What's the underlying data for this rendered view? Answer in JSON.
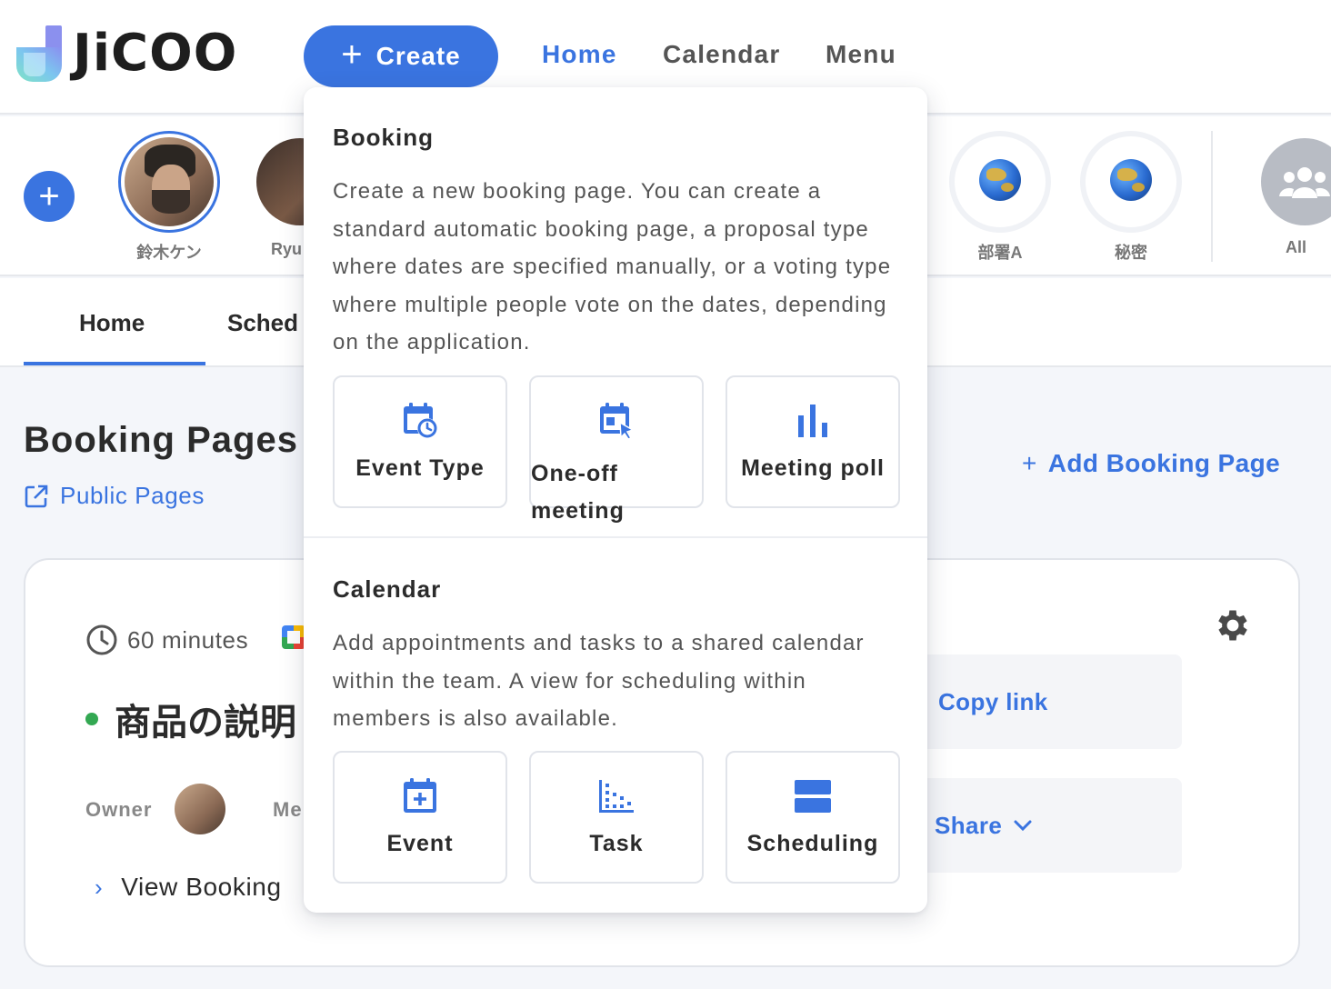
{
  "header": {
    "logo_text": "JiCOO",
    "create_label": "Create",
    "nav": [
      {
        "label": "Home",
        "active": true
      },
      {
        "label": "Calendar",
        "active": false
      },
      {
        "label": "Menu",
        "active": false
      }
    ]
  },
  "members": {
    "items": [
      {
        "label": "鈴木ケン",
        "selected": true
      },
      {
        "label": "Ryu"
      },
      {
        "label": "部署A"
      },
      {
        "label": "秘密"
      },
      {
        "label": "All"
      }
    ]
  },
  "tabs": [
    {
      "label": "Home",
      "active": true
    },
    {
      "label": "Sched"
    }
  ],
  "main": {
    "title": "Booking Pages",
    "public_pages": "Public Pages",
    "add_booking": "Add Booking Page",
    "card": {
      "duration": "60 minutes",
      "title": "商品の説明",
      "owner_label": "Owner",
      "members_label": "Me",
      "view_booking": "View Booking",
      "copy_link": "Copy link",
      "share": "Share"
    }
  },
  "dropdown": {
    "booking": {
      "title": "Booking",
      "description": "Create a new booking page. You can create a standard automatic booking page, a proposal type where dates are specified manually, or a voting type where multiple people vote on the dates, depending on the application.",
      "options": [
        {
          "label": "Event Type",
          "icon": "calendar-clock-icon"
        },
        {
          "label": "One-off meeting",
          "icon": "calendar-cursor-icon"
        },
        {
          "label": "Meeting poll",
          "icon": "bar-chart-icon"
        }
      ]
    },
    "calendar": {
      "title": "Calendar",
      "description": "Add appointments and tasks to a shared calendar within the team. A view for scheduling within members is also available.",
      "options": [
        {
          "label": "Event",
          "icon": "calendar-plus-icon"
        },
        {
          "label": "Task",
          "icon": "task-chart-icon"
        },
        {
          "label": "Scheduling",
          "icon": "scheduling-icon"
        }
      ]
    }
  },
  "colors": {
    "accent": "#3a74e0",
    "status_active": "#33a852"
  }
}
